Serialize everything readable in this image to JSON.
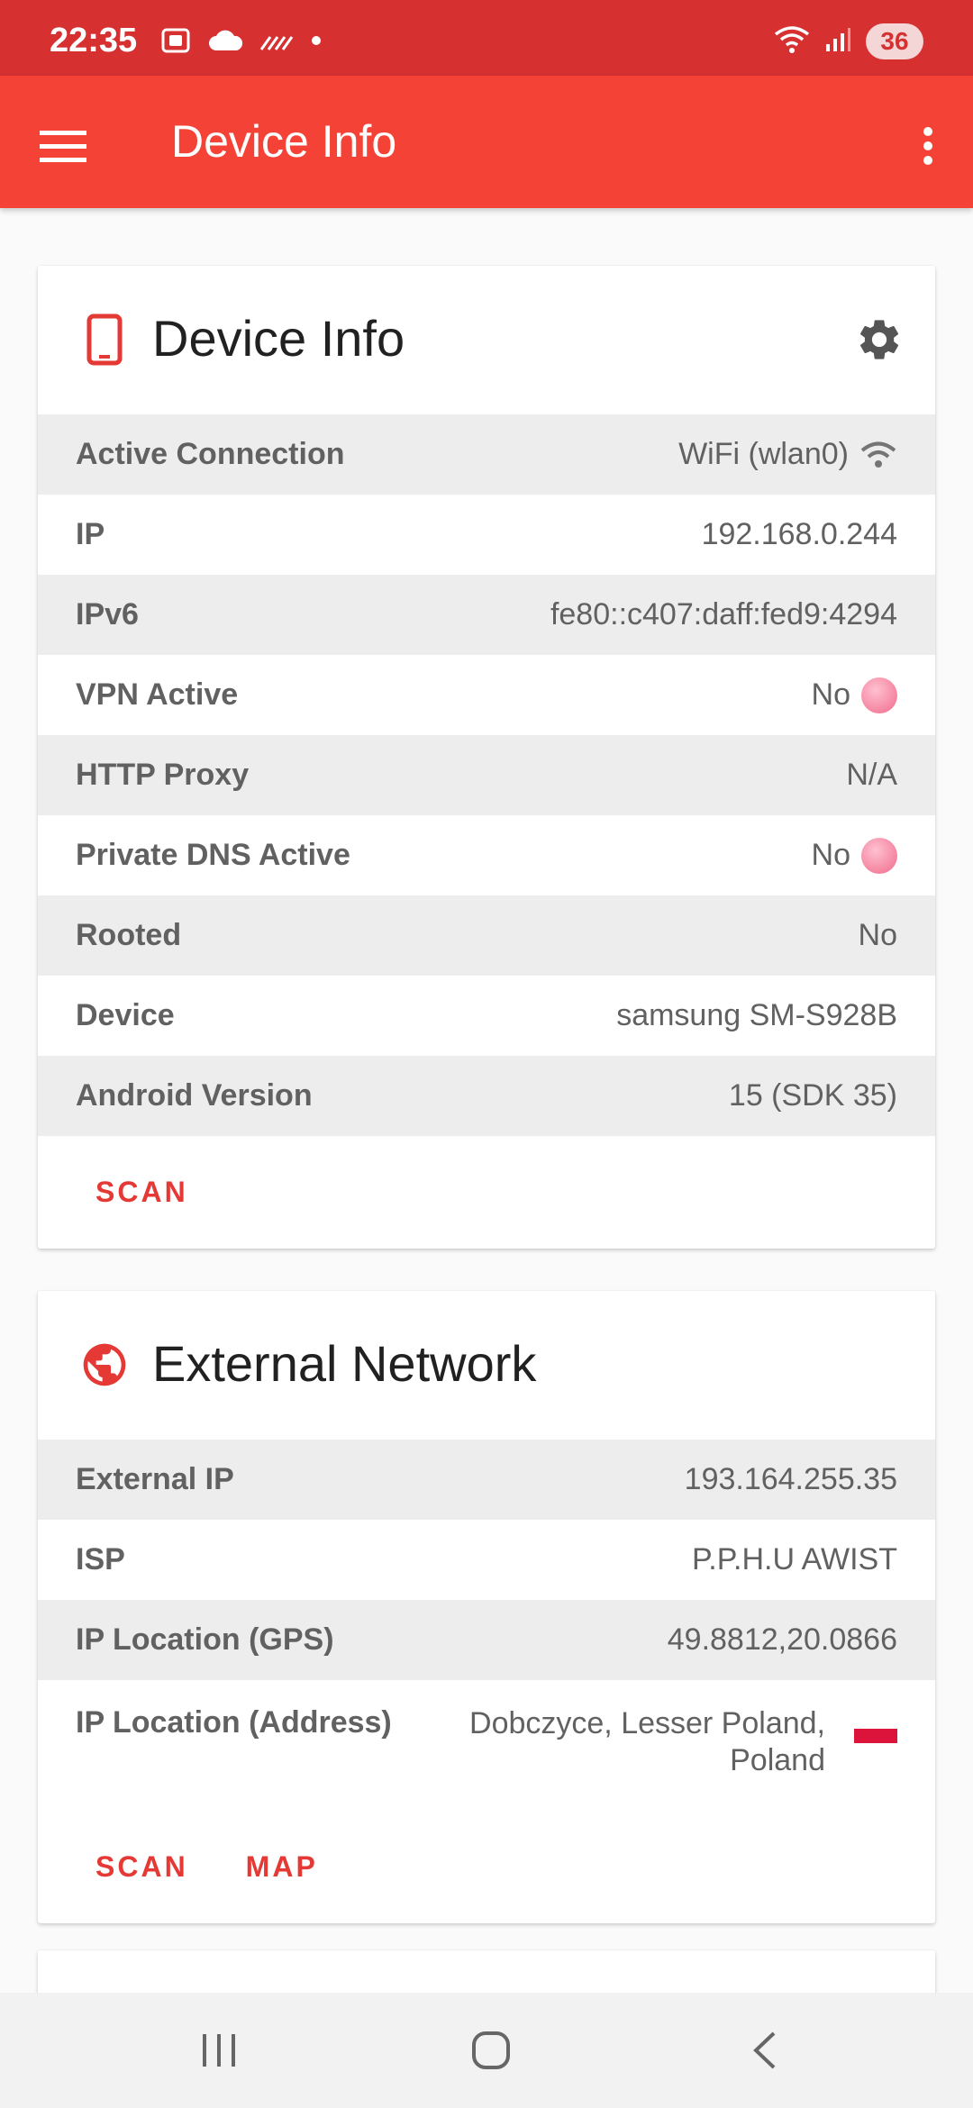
{
  "status_bar": {
    "time": "22:35",
    "battery": "36",
    "icons": [
      "screenshot-icon",
      "cloud-icon",
      "signal-slash-icon",
      "dot-icon",
      "wifi-icon",
      "cellular-signal-icon"
    ]
  },
  "app_bar": {
    "title": "Device Info"
  },
  "device_card": {
    "title": "Device Info",
    "rows": [
      {
        "label": "Active Connection",
        "value": "WiFi (wlan0)"
      },
      {
        "label": "IP",
        "value": "192.168.0.244"
      },
      {
        "label": "IPv6",
        "value": "fe80::c407:daff:fed9:4294"
      },
      {
        "label": "VPN Active",
        "value": "No"
      },
      {
        "label": "HTTP Proxy",
        "value": "N/A"
      },
      {
        "label": "Private DNS Active",
        "value": "No"
      },
      {
        "label": "Rooted",
        "value": "No"
      },
      {
        "label": "Device",
        "value": "samsung SM-S928B"
      },
      {
        "label": "Android Version",
        "value": "15 (SDK 35)"
      }
    ],
    "scan_label": "SCAN"
  },
  "external_card": {
    "title": "External Network",
    "rows": [
      {
        "label": "External IP",
        "value": "193.164.255.35"
      },
      {
        "label": "ISP",
        "value": "P.P.H.U AWIST"
      },
      {
        "label": "IP Location (GPS)",
        "value": "49.8812,20.0866"
      },
      {
        "label": "IP Location (Address)",
        "value": "Dobczyce, Lesser Poland, Poland"
      }
    ],
    "scan_label": "SCAN",
    "map_label": "MAP"
  },
  "colors": {
    "status_bar": "#d63031",
    "app_bar": "#f44336",
    "accent": "#e53935",
    "row_shade": "#ededed"
  }
}
